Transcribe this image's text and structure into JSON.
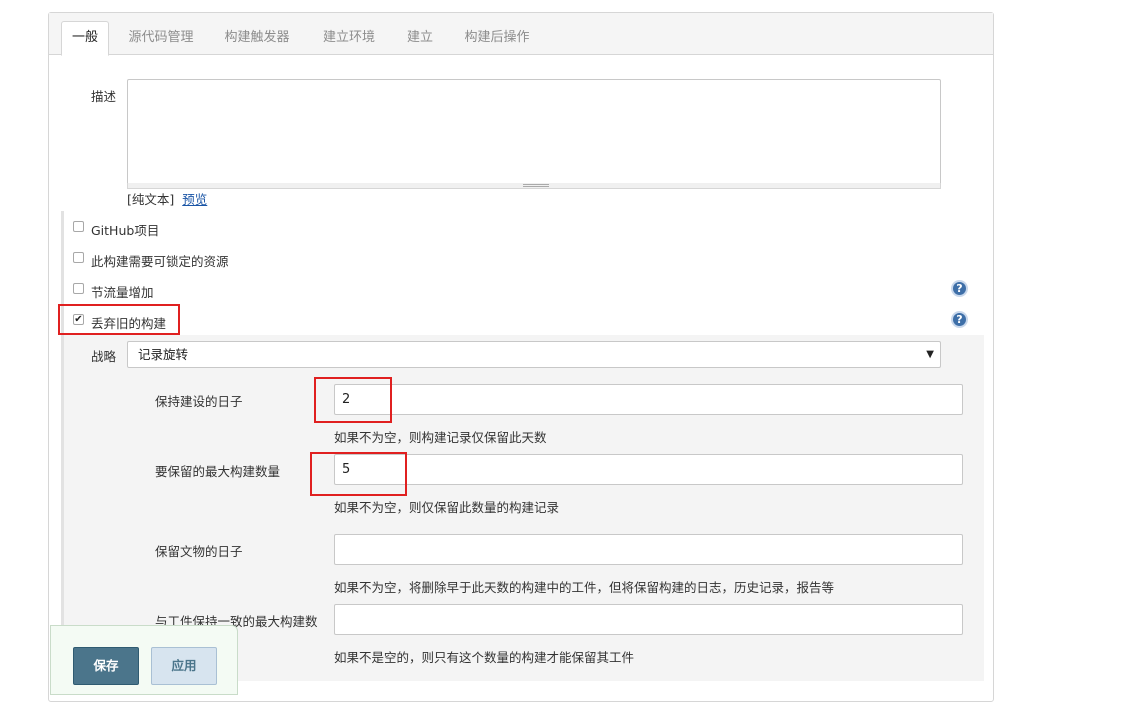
{
  "tabs": [
    "一般",
    "源代码管理",
    "构建触发器",
    "建立环境",
    "建立",
    "构建后操作"
  ],
  "description": {
    "label": "描述",
    "value": "",
    "plain_text": "[纯文本]",
    "preview_link": "预览"
  },
  "options": [
    {
      "label": "GitHub项目",
      "checked": false
    },
    {
      "label": "此构建需要可锁定的资源",
      "checked": false
    },
    {
      "label": "节流量增加",
      "checked": false
    },
    {
      "label": "丢弃旧的构建",
      "checked": true
    }
  ],
  "help_icon": "?",
  "checkmark": "✔",
  "discard": {
    "strategy_label": "战略",
    "strategy_value": "记录旋转",
    "dropdown_arrow": "▼",
    "fields": [
      {
        "label": "保持建设的日子",
        "value": "2",
        "hint": "如果不为空，则构建记录仅保留此天数"
      },
      {
        "label": "要保留的最大构建数量",
        "value": "5",
        "hint": "如果不为空，则仅保留此数量的构建记录"
      },
      {
        "label": "保留文物的日子",
        "value": "",
        "hint": "如果不为空，将删除早于此天数的构建中的工件，但将保留构建的日志，历史记录，报告等"
      },
      {
        "label": "与工件保持一致的最大构建数",
        "value": "",
        "hint": "如果不是空的，则只有这个数量的构建才能保留其工件"
      }
    ]
  },
  "buttons": {
    "save": "保存",
    "apply": "应用"
  },
  "colors": {
    "highlight": "#e02020",
    "save_button": "#4b758b",
    "link": "#1a55a6",
    "help_icon": "#3e6fa8"
  }
}
